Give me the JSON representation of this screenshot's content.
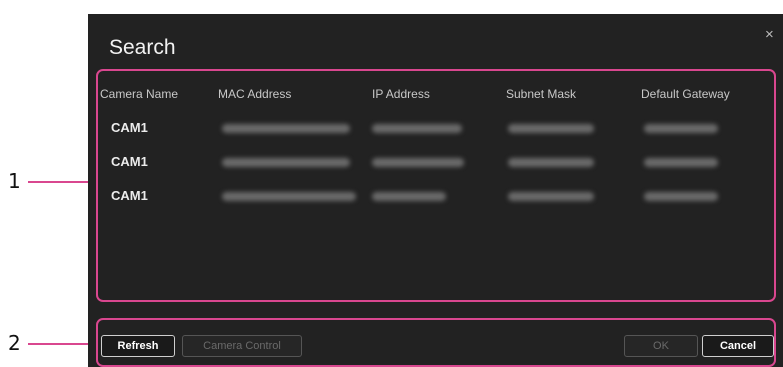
{
  "callouts": [
    "1",
    "2"
  ],
  "dialog": {
    "title": "Search",
    "close_glyph": "×"
  },
  "table": {
    "headers": [
      "Camera Name",
      "MAC Address",
      "IP Address",
      "Subnet Mask",
      "Default Gateway"
    ],
    "rows": [
      {
        "camera_name": "CAM1"
      },
      {
        "camera_name": "CAM1"
      },
      {
        "camera_name": "CAM1"
      }
    ]
  },
  "buttons": {
    "refresh": "Refresh",
    "camera_control": "Camera Control",
    "ok": "OK",
    "cancel": "Cancel"
  },
  "colors": {
    "callout_highlight": "#d9478f",
    "dialog_background": "#222222"
  }
}
